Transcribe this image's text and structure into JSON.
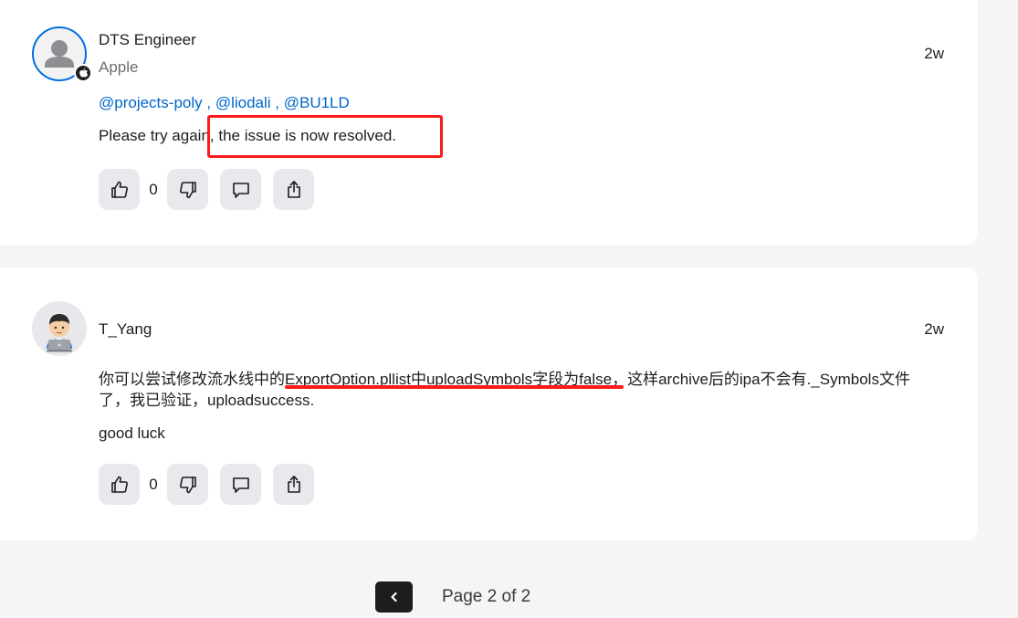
{
  "posts": [
    {
      "author": "DTS Engineer",
      "org": "Apple",
      "time": "2w",
      "mentions": [
        "@projects-poly",
        "@liodali",
        "@BU1LD"
      ],
      "mention_separator": " , ",
      "body": [
        "Please try again, the issue is now resolved."
      ],
      "votes": "0",
      "avatar_icon": "person-icon",
      "badge_icon": "apple-logo-icon"
    },
    {
      "author": "T_Yang",
      "time": "2w",
      "body": [
        "你可以尝试修改流水线中的ExportOption.pllist中uploadSymbols字段为false，这样archive后的ipa不会有._Symbols文件了，我已验证，uploadsuccess.",
        "good luck"
      ],
      "votes": "0",
      "avatar_icon": "memoji-laptop-icon"
    }
  ],
  "pagination": {
    "label": "Page 2 of 2",
    "prev_icon": "chevron-left-icon"
  },
  "colors": {
    "accent": "#0066cc",
    "annotation": "#ff1a1a",
    "button_bg": "#e8e8ed",
    "page_bg": "#f5f5f7"
  }
}
